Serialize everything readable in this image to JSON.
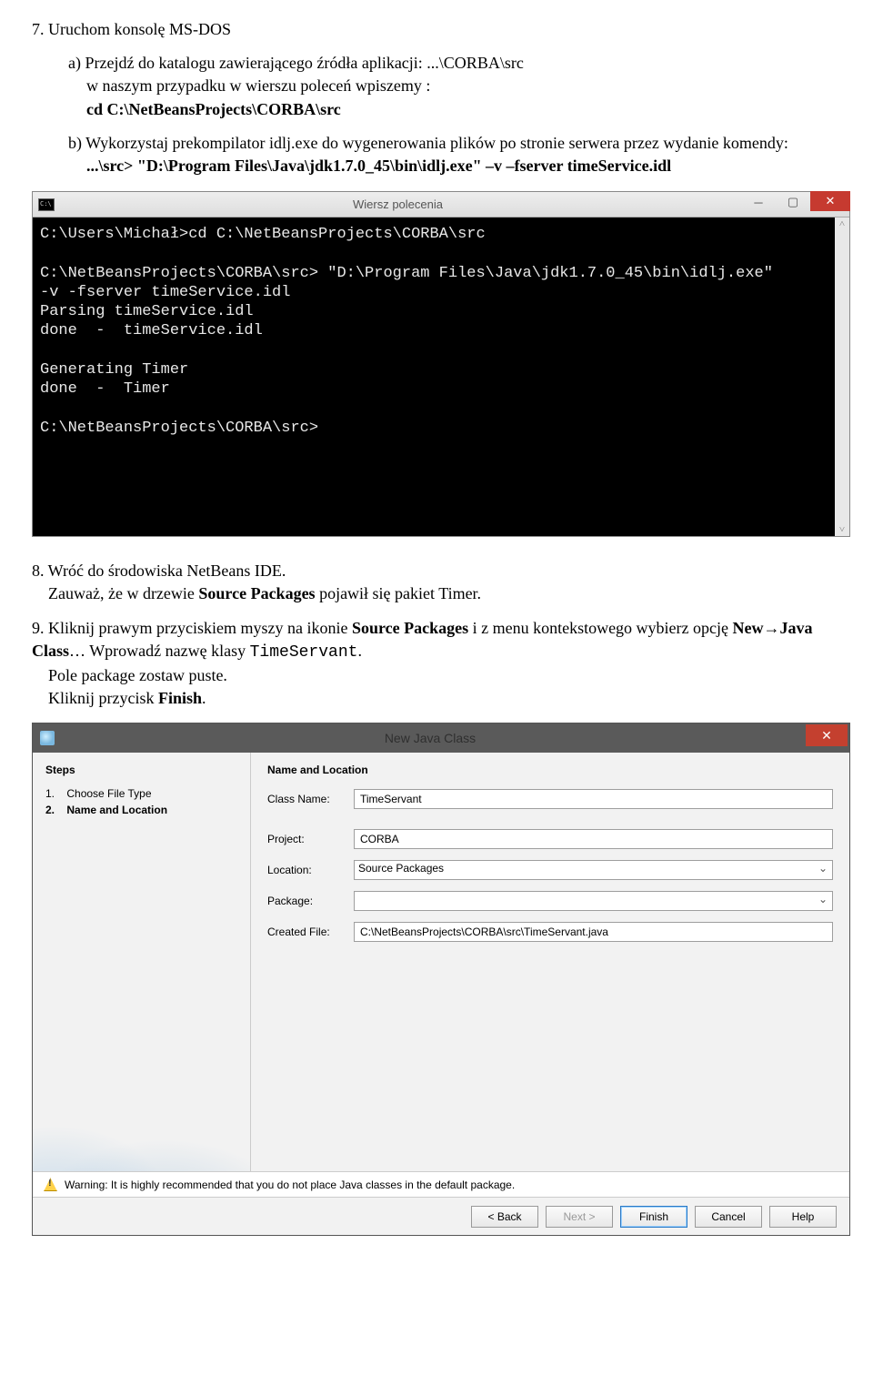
{
  "step7": {
    "title": "7. Uruchom konsolę MS-DOS",
    "a_line": "a) Przejdź do katalogu zawierającego źródła aplikacji: ...\\CORBA\\src",
    "a_sub1": "w naszym przypadku w wierszu poleceń wpiszemy :",
    "a_cmd": "cd C:\\NetBeansProjects\\CORBA\\src",
    "b_line": "b) Wykorzystaj prekompilator idlj.exe do wygenerowania plików po stronie serwera przez wydanie komendy:",
    "b_cmd": "...\\src> \"D:\\Program Files\\Java\\jdk1.7.0_45\\bin\\idlj.exe\" –v –fserver timeService.idl"
  },
  "cmd": {
    "title": "Wiersz polecenia",
    "content": "C:\\Users\\Michał>cd C:\\NetBeansProjects\\CORBA\\src\n\nC:\\NetBeansProjects\\CORBA\\src> \"D:\\Program Files\\Java\\jdk1.7.0_45\\bin\\idlj.exe\"\n-v -fserver timeService.idl\nParsing timeService.idl\ndone  -  timeService.idl\n\nGenerating Timer\ndone  -  Timer\n\nC:\\NetBeansProjects\\CORBA\\src>"
  },
  "step8": {
    "text1": "8. Wróć do środowiska NetBeans IDE.",
    "text2_a": "Zauważ, że w drzewie ",
    "text2_b": "Source Packages",
    "text2_c": " pojawił się pakiet Timer."
  },
  "step9": {
    "line1_a": "9. Kliknij prawym przyciskiem myszy na ikonie ",
    "line1_b": "Source Packages",
    "line1_c": " i z menu kontekstowego wybierz opcję ",
    "line1_d": "New→Java Class",
    "line1_e": "… Wprowadź nazwę klasy ",
    "line1_f": "TimeServant",
    "line1_g": ".",
    "line2": "Pole package zostaw puste.",
    "line3_a": "Kliknij przycisk ",
    "line3_b": "Finish",
    "line3_c": "."
  },
  "dialog": {
    "title": "New Java Class",
    "steps_heading": "Steps",
    "steps": [
      {
        "num": "1.",
        "label": "Choose File Type",
        "current": false
      },
      {
        "num": "2.",
        "label": "Name and Location",
        "current": true
      }
    ],
    "section_title": "Name and Location",
    "class_name_label": "Class Name:",
    "class_name_value": "TimeServant",
    "project_label": "Project:",
    "project_value": "CORBA",
    "location_label": "Location:",
    "location_value": "Source Packages",
    "package_label": "Package:",
    "package_value": "",
    "created_label": "Created File:",
    "created_value": "C:\\NetBeansProjects\\CORBA\\src\\TimeServant.java",
    "warning": "Warning: It is highly recommended that you do not place Java classes in the default package.",
    "buttons": {
      "back": "< Back",
      "next": "Next >",
      "finish": "Finish",
      "cancel": "Cancel",
      "help": "Help"
    }
  }
}
